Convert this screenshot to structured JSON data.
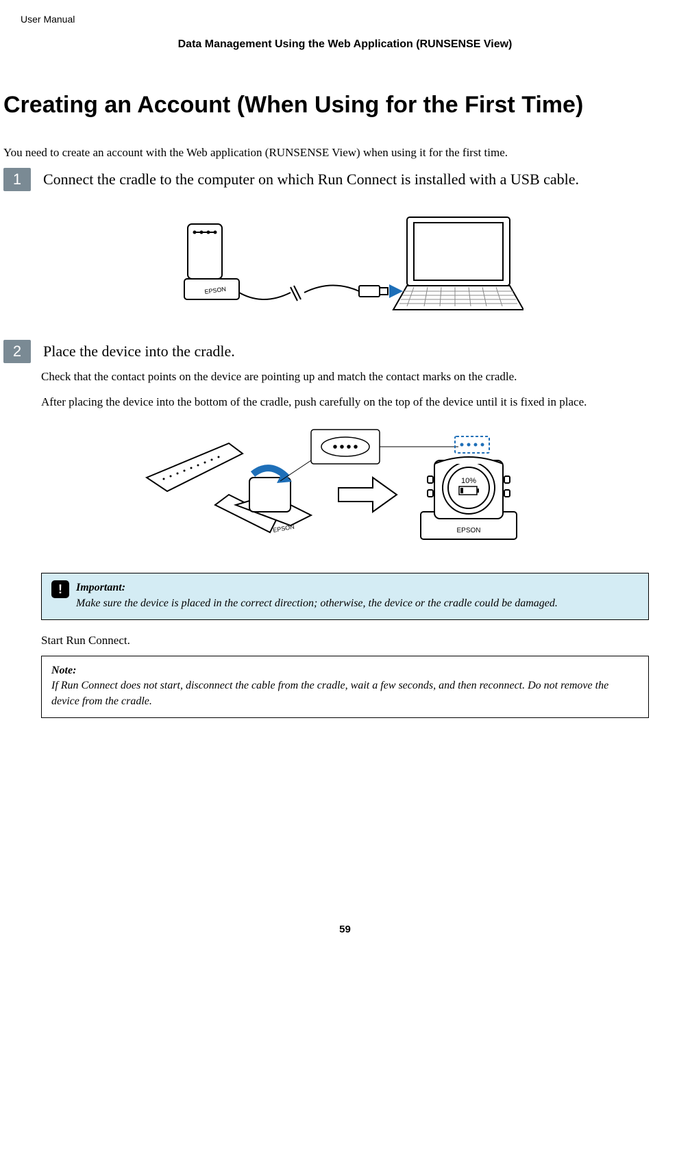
{
  "header": {
    "doc_label": "User Manual",
    "section_title": "Data Management Using the Web Application (RUNSENSE View)"
  },
  "title": "Creating an Account (When Using for the First Time)",
  "intro": "You need to create an account with the Web application (RUNSENSE View) when using it for the first time.",
  "steps": {
    "s1": {
      "num": "1",
      "text": "Connect the cradle to the computer on which Run Connect is installed with a USB cable."
    },
    "s2": {
      "num": "2",
      "text": "Place the device into the cradle.",
      "detail1": "Check that the contact points on the device are pointing up and match the contact marks on the cradle.",
      "detail2": "After placing the device into the bottom of the cradle, push carefully on the top of the device until it is fixed in place."
    }
  },
  "figure_labels": {
    "epson": "EPSON",
    "battery_pct": "10%"
  },
  "important": {
    "label": "Important:",
    "text": "Make sure the device is placed in the correct direction; otherwise, the device or the cradle could be damaged.",
    "icon_glyph": "!"
  },
  "start_text": "Start Run Connect.",
  "note": {
    "label": "Note:",
    "text": "If Run Connect does not start, disconnect the cable from the cradle, wait a few seconds, and then reconnect. Do not remove the device from the cradle."
  },
  "page_number": "59"
}
